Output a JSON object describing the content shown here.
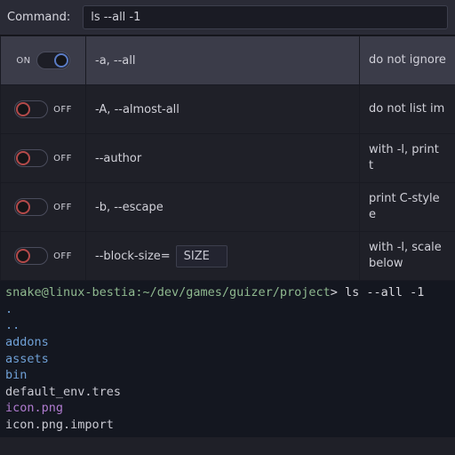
{
  "topbar": {
    "label": "Command:",
    "value": "ls --all -1"
  },
  "toggle_labels": {
    "on": "ON",
    "off": "OFF"
  },
  "options": [
    {
      "on": true,
      "opt": "-a, --all",
      "desc": "do not ignore",
      "highlight": true
    },
    {
      "on": false,
      "opt": "-A, --almost-all",
      "desc": "do not list im"
    },
    {
      "on": false,
      "opt": "--author",
      "desc": "with -l, print t"
    },
    {
      "on": false,
      "opt": "-b, --escape",
      "desc": "print C-style e"
    },
    {
      "on": false,
      "opt": "--block-size=",
      "desc": "with -l, scale\nbelow",
      "value_input": "SIZE"
    }
  ],
  "terminal": {
    "prompt": {
      "user": "snake",
      "host": "linux-bestia",
      "path": "~/dev/games/guizer/project",
      "symbol": ">",
      "command": "ls --all -1"
    },
    "lines": [
      {
        "text": ".",
        "cls": "f-dot"
      },
      {
        "text": "..",
        "cls": "f-dot"
      },
      {
        "text": "addons",
        "cls": "f-dir"
      },
      {
        "text": "assets",
        "cls": "f-dir"
      },
      {
        "text": "bin",
        "cls": "f-dir"
      },
      {
        "text": "default_env.tres",
        "cls": "f-file"
      },
      {
        "text": "icon.png",
        "cls": "f-img"
      },
      {
        "text": "icon.png.import",
        "cls": "f-file"
      }
    ]
  }
}
